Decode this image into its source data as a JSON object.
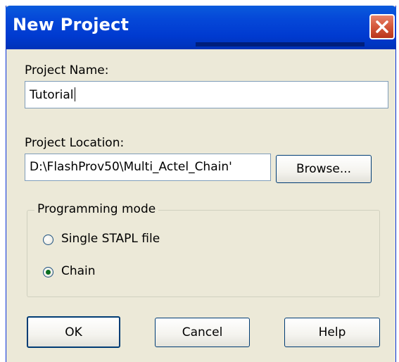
{
  "window": {
    "title": "New Project",
    "close_icon": "close-icon"
  },
  "project_name": {
    "label": "Project Name:",
    "value": "Tutorial"
  },
  "project_location": {
    "label": "Project Location:",
    "value": "D:\\FlashProv50\\Multi_Actel_Chain'",
    "browse_label": "Browse..."
  },
  "programming_mode": {
    "title": "Programming mode",
    "options": [
      {
        "label": "Single STAPL file",
        "selected": false
      },
      {
        "label": "Chain",
        "selected": true
      }
    ]
  },
  "buttons": {
    "ok": "OK",
    "cancel": "Cancel",
    "help": "Help"
  },
  "colors": {
    "title_bar": "#0548d8",
    "close_button": "#d4573a",
    "dialog_face": "#ece9d8"
  }
}
